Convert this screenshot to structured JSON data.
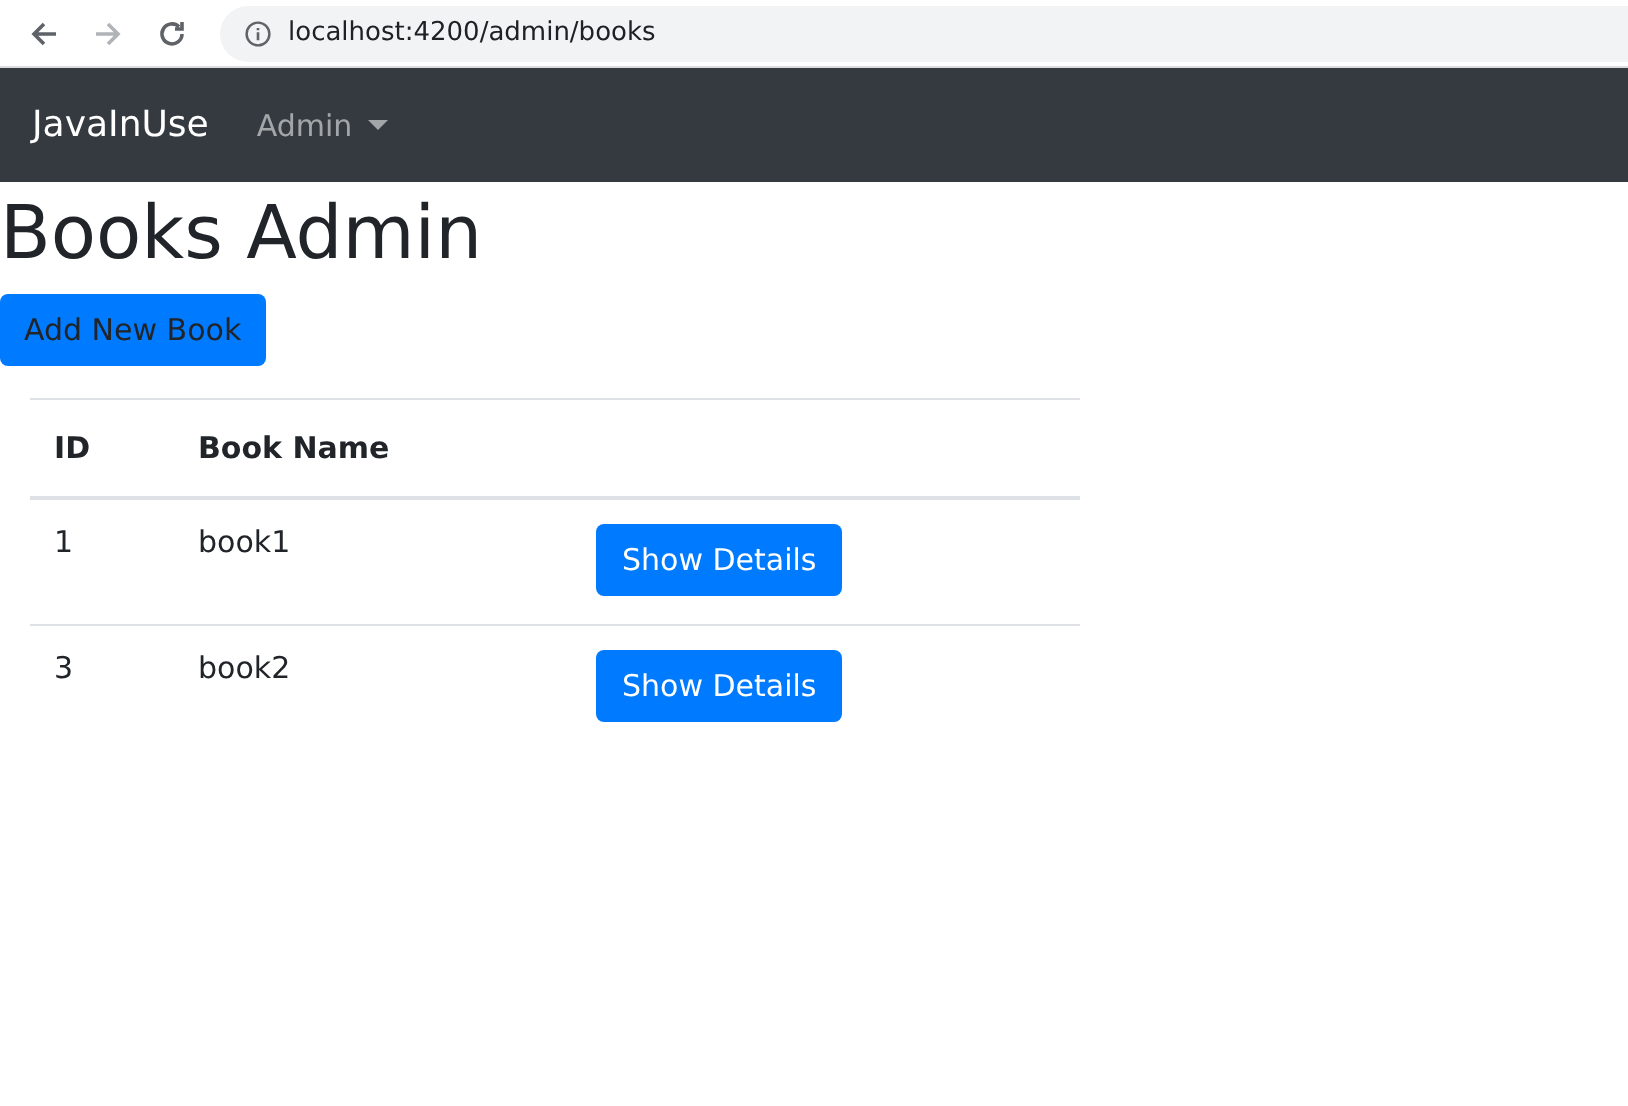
{
  "browser": {
    "url": "localhost:4200/admin/books"
  },
  "navbar": {
    "brand": "JavaInUse",
    "menu": "Admin"
  },
  "heading": "Books Admin",
  "add_button": "Add New Book",
  "table": {
    "columns": [
      "ID",
      "Book Name"
    ],
    "rows": [
      {
        "id": "1",
        "name": "book1",
        "action": "Show Details"
      },
      {
        "id": "3",
        "name": "book2",
        "action": "Show Details"
      }
    ]
  }
}
